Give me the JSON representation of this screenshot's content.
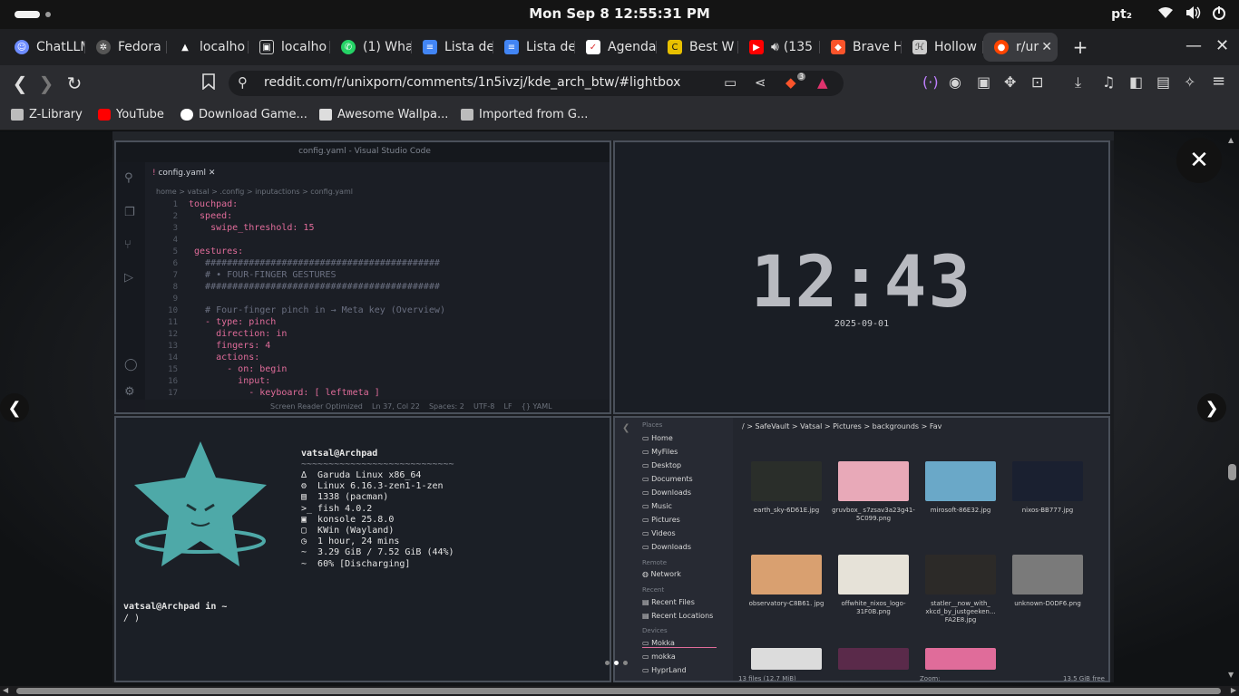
{
  "system_bar": {
    "datetime": "Mon Sep 8  12:55:31 PM",
    "keyboard_layout": "pt₂",
    "icons": [
      "wifi-icon",
      "volume-icon",
      "power-icon"
    ]
  },
  "tabs": [
    {
      "label": "ChatLLM",
      "icon": "chat-icon",
      "color": "#6d8cff"
    },
    {
      "label": "Fedora",
      "icon": "fedora-icon",
      "color": "#5a5a5a"
    },
    {
      "label": "localho",
      "icon": "arch-icon",
      "color": "#5a5a5a"
    },
    {
      "label": "localho",
      "icon": "image-icon",
      "color": "#5a5a5a"
    },
    {
      "label": "(1) Wha",
      "icon": "whatsapp-icon",
      "color": "#25d366"
    },
    {
      "label": "Lista de",
      "icon": "doc-icon",
      "color": "#4285f4"
    },
    {
      "label": "Lista de",
      "icon": "doc-icon",
      "color": "#4285f4"
    },
    {
      "label": "Agenda",
      "icon": "check-icon",
      "color": "#ffffff"
    },
    {
      "label": "Best W",
      "icon": "c-icon",
      "color": "#e8c000"
    },
    {
      "label": "(135",
      "icon": "youtube-icon",
      "color": "#ff0000"
    },
    {
      "label": "Brave H",
      "icon": "brave-icon",
      "color": "#fb542b"
    },
    {
      "label": "Hollow",
      "icon": "hk-icon",
      "color": "#cccccc"
    },
    {
      "label": "r/ur",
      "icon": "reddit-icon",
      "color": "#ff4500",
      "active": true
    }
  ],
  "address_bar": {
    "url": "reddit.com/r/unixporn/comments/1n5ivzj/kde_arch_btw/#lightbox",
    "brave_badge": "3"
  },
  "bookmarks": [
    {
      "label": "Z-Library",
      "icon": "folder-icon",
      "color": "#bcbcbc"
    },
    {
      "label": "YouTube",
      "icon": "youtube-icon",
      "color": "#ff0000"
    },
    {
      "label": "Download Game...",
      "icon": "wordpress-icon",
      "color": "#ffffff"
    },
    {
      "label": "Awesome Wallpa...",
      "icon": "wallpaper-icon",
      "color": "#dddddd"
    },
    {
      "label": "Imported from G...",
      "icon": "folder-icon",
      "color": "#bcbcbc"
    }
  ],
  "lightbox": {
    "code_editor": {
      "title": "config.yaml - Visual Studio Code",
      "tab": "config.yaml",
      "breadcrumb": "home > vatsal > .config > inputactions > config.yaml",
      "lines": [
        {
          "n": "1",
          "text": "touchpad:",
          "color": "#e06c9a"
        },
        {
          "n": "2",
          "text": "  speed:",
          "color": "#e06c9a"
        },
        {
          "n": "3",
          "text": "    swipe_threshold: 15",
          "color": "#e06c9a"
        },
        {
          "n": "4",
          "text": "",
          "color": "#cccccc"
        },
        {
          "n": "5",
          "text": " gestures:",
          "color": "#e06c9a"
        },
        {
          "n": "6",
          "text": "   ###########################################",
          "color": "#6a6f80"
        },
        {
          "n": "7",
          "text": "   # • FOUR-FINGER GESTURES",
          "color": "#6a6f80"
        },
        {
          "n": "8",
          "text": "   ###########################################",
          "color": "#6a6f80"
        },
        {
          "n": "9",
          "text": "",
          "color": "#cccccc"
        },
        {
          "n": "10",
          "text": "   # Four-finger pinch in → Meta key (Overview)",
          "color": "#6a6f80"
        },
        {
          "n": "11",
          "text": "   - type: pinch",
          "color": "#e06c9a"
        },
        {
          "n": "12",
          "text": "     direction: in",
          "color": "#e06c9a"
        },
        {
          "n": "13",
          "text": "     fingers: 4",
          "color": "#e06c9a"
        },
        {
          "n": "14",
          "text": "     actions:",
          "color": "#e06c9a"
        },
        {
          "n": "15",
          "text": "       - on: begin",
          "color": "#e06c9a"
        },
        {
          "n": "16",
          "text": "         input:",
          "color": "#e06c9a"
        },
        {
          "n": "17",
          "text": "           - keyboard: [ leftmeta ]",
          "color": "#e06c9a"
        }
      ],
      "status": "Screen Reader Optimized    Ln 37, Col 22    Spaces: 2    UTF-8    LF    {} YAML"
    },
    "clock_widget": {
      "time": "12:43",
      "date": "2025-09-01"
    },
    "terminal": {
      "user_host": "vatsal@Archpad",
      "separator": "~~~~~~~~~~~~~~~~~~~~~~~~~~~~",
      "info": [
        "∆  Garuda Linux x86_64",
        "⚙  Linux 6.16.3-zen1-1-zen",
        "▤  1338 (pacman)",
        ">_ fish 4.0.2",
        "▣  konsole 25.8.0",
        "▢  KWin (Wayland)",
        "◷  1 hour, 24 mins",
        "~  3.29 GiB / 7.52 GiB (44%)",
        "~  60% [Discharging]"
      ],
      "prompt": "vatsal@Archpad in ~",
      "prompt2": "∕ )"
    },
    "file_manager": {
      "breadcrumb": "/ > SafeVault > Vatsal > Pictures > backgrounds > Fav",
      "sidebar_places": [
        "Home",
        "MyFiles",
        "Desktop",
        "Documents",
        "Downloads",
        "Music",
        "Pictures",
        "Videos",
        "Downloads"
      ],
      "sidebar_remote": [
        "Network"
      ],
      "sidebar_recent": [
        "Recent Files",
        "Recent Locations"
      ],
      "sidebar_devices": [
        "Mokka",
        "mokka",
        "HyprLand"
      ],
      "section_places": "Places",
      "section_remote": "Remote",
      "section_recent": "Recent",
      "section_devices": "Devices",
      "files": [
        {
          "name": "earth_sky-6D61E.jpg",
          "color": "#2a2e2a"
        },
        {
          "name": "gruvbox_ s7zsav3a23g41- 5C099.png",
          "color": "#e8a9b8"
        },
        {
          "name": "mirosoft-86E32.jpg",
          "color": "#6aa8c8"
        },
        {
          "name": "nixos-BB777.jpg",
          "color": "#1a2030"
        },
        {
          "name": "observatory-C8B61. jpg",
          "color": "#d9a070"
        },
        {
          "name": "offwhite_nixos_logo- 31F0B.png",
          "color": "#e6e2d8"
        },
        {
          "name": "statler__now_with_ xkcd_by_justgeeken... FA2E8.jpg",
          "color": "#2c2a28"
        },
        {
          "name": "unknown-D0DF6.png",
          "color": "#7a7a7a"
        }
      ],
      "status_left": "13 files (12.7 MiB)",
      "status_zoom": "Zoom:",
      "status_right": "13.5 GiB free"
    },
    "pagination": {
      "count": 3,
      "active": 2
    }
  }
}
